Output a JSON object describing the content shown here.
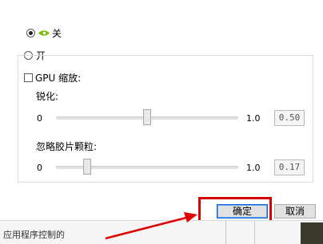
{
  "image_mode": {
    "option_on_label": "关",
    "option_off_label": "开"
  },
  "gpu_scaling": {
    "label": "GPU 缩放:"
  },
  "sharpen": {
    "label": "锐化:",
    "min": "0",
    "max": "1.0",
    "value": "0.50",
    "fraction": 0.5
  },
  "film_grain": {
    "label": "忽略胶片颗粒:",
    "min": "0",
    "max": "1.0",
    "value": "0.17",
    "fraction": 0.17
  },
  "buttons": {
    "ok": "确定",
    "cancel": "取消"
  },
  "status": {
    "text": "应用程序控制的"
  },
  "colors": {
    "highlight": "#d40000",
    "nvidia_green": "#76b900"
  }
}
